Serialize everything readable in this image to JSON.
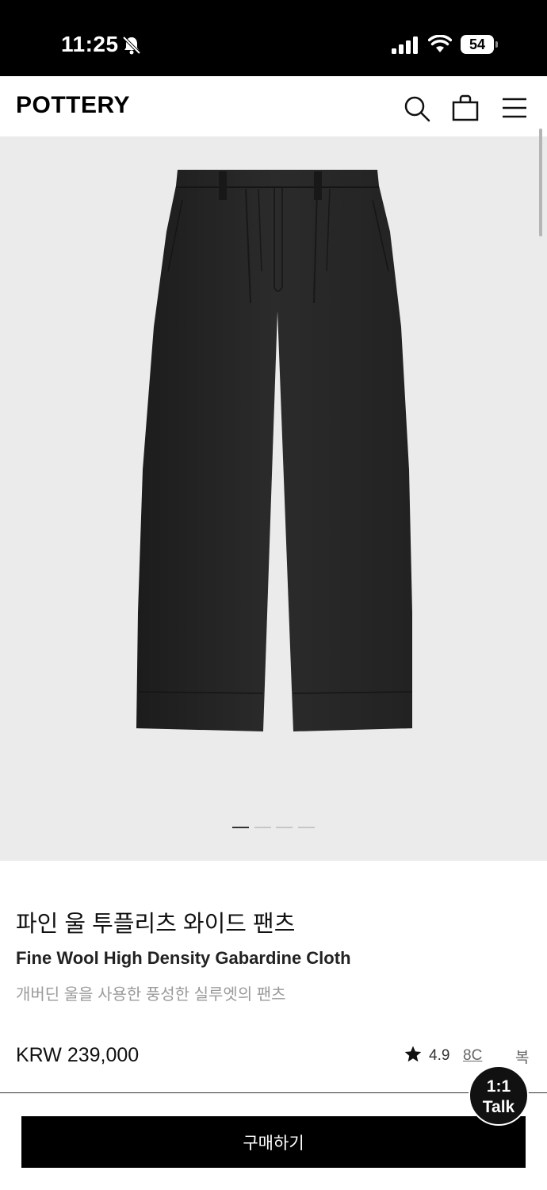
{
  "status_bar": {
    "time": "11:25",
    "battery": "54"
  },
  "header": {
    "logo": "POTTERY"
  },
  "gallery": {
    "slide_count": 4,
    "active_slide": 1
  },
  "product": {
    "name_ko": "파인 울 투플리츠 와이드 팬츠",
    "name_en": "Fine Wool High Density Gabardine Cloth",
    "description": "개버딘 울을 사용한 풍성한 실루엣의 팬츠",
    "price": "KRW 239,000",
    "rating": "4.9",
    "review_count": "8C",
    "review_suffix": "복"
  },
  "actions": {
    "buy_label": "구매하기"
  },
  "chat": {
    "line1": "1:1",
    "line2": "Talk"
  },
  "icons": [
    "bell-slash-icon",
    "signal-icon",
    "wifi-icon",
    "search-icon",
    "shopping-bag-icon",
    "hamburger-menu-icon",
    "star-icon"
  ]
}
